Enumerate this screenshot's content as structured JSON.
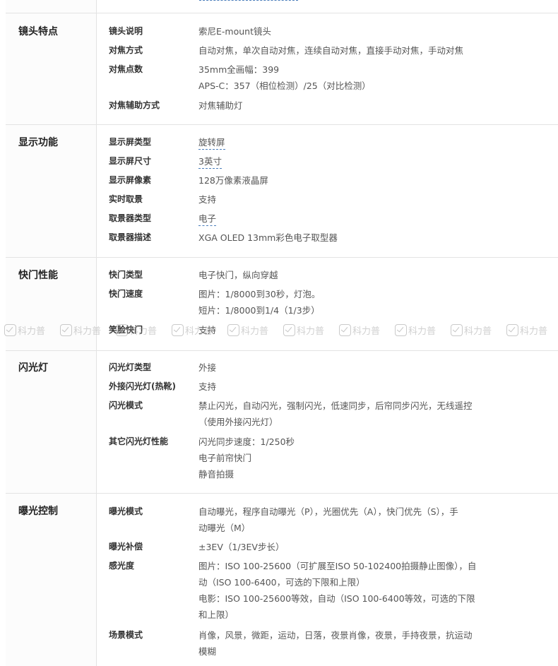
{
  "sections": [
    {
      "category": "镜头特点",
      "rows": [
        {
          "label": "镜头说明",
          "lines": [
            "索尼E-mount镜头"
          ]
        },
        {
          "label": "对焦方式",
          "lines": [
            "自动对焦，单次自动对焦，连续自动对焦，直接手动对焦，手动对焦"
          ]
        },
        {
          "label": "对焦点数",
          "lines": [
            "35mm全画幅：399",
            "APS-C：357（相位检测）/25（对比检测）"
          ]
        },
        {
          "label": "对焦辅助方式",
          "lines": [
            "对焦辅助灯"
          ]
        }
      ]
    },
    {
      "category": "显示功能",
      "rows": [
        {
          "label": "显示屏类型",
          "lines": [
            "旋转屏"
          ]
        },
        {
          "label": "显示屏尺寸",
          "lines": [
            "3英寸"
          ]
        },
        {
          "label": "显示屏像素",
          "lines": [
            "128万像素液晶屏"
          ]
        },
        {
          "label": "实时取景",
          "lines": [
            "支持"
          ]
        },
        {
          "label": "取景器类型",
          "lines": [
            "电子"
          ]
        },
        {
          "label": "取景器描述",
          "lines": [
            "XGA OLED 13mm彩色电子取型器"
          ]
        }
      ]
    },
    {
      "category": "快门性能",
      "rows": [
        {
          "label": "快门类型",
          "lines": [
            "电子快门，纵向穿越"
          ]
        },
        {
          "label": "快门速度",
          "lines": [
            "图片：1/8000到30秒，灯泡。",
            "短片：1/8000到1/4（1/3步）"
          ]
        },
        {
          "label": "笑脸快门",
          "lines": [
            "支持"
          ]
        }
      ]
    },
    {
      "category": "闪光灯",
      "rows": [
        {
          "label": "闪光灯类型",
          "lines": [
            "外接"
          ]
        },
        {
          "label": "外接闪光灯(热靴)",
          "lines": [
            "支持"
          ]
        },
        {
          "label": "闪光模式",
          "lines": [
            "禁止闪光，自动闪光，强制闪光，低速同步，后帘同步闪光，无线遥控",
            "（使用外接闪光灯）"
          ]
        },
        {
          "label": "其它闪光灯性能",
          "lines": [
            "闪光同步速度：1/250秒",
            "电子前帘快门",
            "静音拍摄"
          ]
        }
      ]
    },
    {
      "category": "曝光控制",
      "rows": [
        {
          "label": "曝光模式",
          "lines": [
            "自动曝光，程序自动曝光（P），光圈优先（A），快门优先（S），手",
            "动曝光（M）"
          ]
        },
        {
          "label": "曝光补偿",
          "lines": [
            "±3EV（1/3EV步长）"
          ]
        },
        {
          "label": "感光度",
          "lines": [
            "图片：ISO 100-25600（可扩展至ISO 50-102400拍摄静止图像），自",
            "动（ISO 100-6400，可选的下限和上限）",
            "电影：ISO 100-25600等效，自动（ISO 100-6400等效，可选的下限",
            "和上限）"
          ]
        },
        {
          "label": "场景模式",
          "lines": [
            "肖像，风景，微距，运动，日落，夜景肖像，夜景，手持夜景，抗运动",
            "模糊"
          ]
        }
      ]
    }
  ],
  "watermark": {
    "text": "科力普",
    "icon": "check-badge-icon",
    "count": 10
  }
}
